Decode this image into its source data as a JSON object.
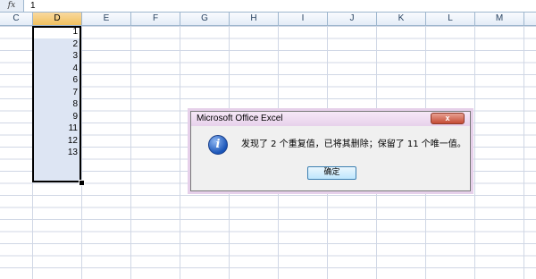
{
  "formula_bar": {
    "fx_label": "fx",
    "value": "1"
  },
  "columns": [
    {
      "label": "C"
    },
    {
      "label": "D"
    },
    {
      "label": "E"
    },
    {
      "label": "F"
    },
    {
      "label": "G"
    },
    {
      "label": "H"
    },
    {
      "label": "I"
    },
    {
      "label": "J"
    },
    {
      "label": "K"
    },
    {
      "label": "L"
    },
    {
      "label": "M"
    }
  ],
  "selected_column": "D",
  "column_d_values": [
    "1",
    "2",
    "3",
    "4",
    "6",
    "7",
    "8",
    "9",
    "11",
    "12",
    "13"
  ],
  "dialog": {
    "title": "Microsoft Office Excel",
    "close_label": "x",
    "icon": "info-icon",
    "message": "发现了 2 个重复值，已将其删除；保留了 11 个唯一值。",
    "ok_label": "确定"
  },
  "colors": {
    "selected_header": "#f1c15f",
    "selection_fill": "#dde5f3",
    "dialog_title": "#e7d1eb",
    "close_button": "#c44a33"
  }
}
